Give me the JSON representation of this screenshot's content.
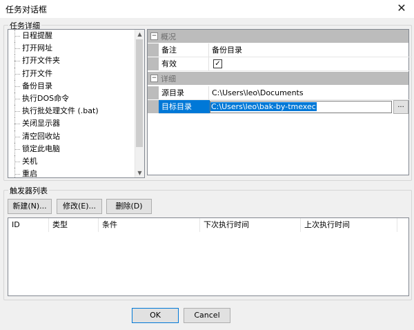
{
  "window": {
    "title": "任务对话框",
    "close_glyph": "✕"
  },
  "task_details": {
    "label": "任务详细",
    "tree_items": [
      "日程提醒",
      "打开网址",
      "打开文件夹",
      "打开文件",
      "备份目录",
      "执行DOS命令",
      "执行批处理文件 (.bat)",
      "关闭显示器",
      "清空回收站",
      "锁定此电脑",
      "关机",
      "重启"
    ],
    "selected_index": 4
  },
  "properties": {
    "overview": {
      "label": "概况",
      "toggle": "−"
    },
    "note": {
      "name": "备注",
      "value": "备份目录"
    },
    "enabled": {
      "name": "有效",
      "checked": true,
      "check_glyph": "✓"
    },
    "details": {
      "label": "详细",
      "toggle": "−"
    },
    "source": {
      "name": "源目录",
      "value": "C:\\Users\\leo\\Documents"
    },
    "target": {
      "name": "目标目录",
      "value": "C:\\Users\\leo\\bak-by-tmexec"
    },
    "browse_label": "..."
  },
  "triggers": {
    "label": "触发器列表",
    "new_label": "新建(N)...",
    "edit_label": "修改(E)...",
    "delete_label": "删除(D)",
    "columns": [
      "ID",
      "类型",
      "条件",
      "下次执行时间",
      "上次执行时间"
    ]
  },
  "footer": {
    "ok_label": "OK",
    "cancel_label": "Cancel"
  },
  "colors": {
    "selection": "#0078d7",
    "section_bg": "#bcbcbc",
    "window_bg": "#f0f0f0"
  }
}
